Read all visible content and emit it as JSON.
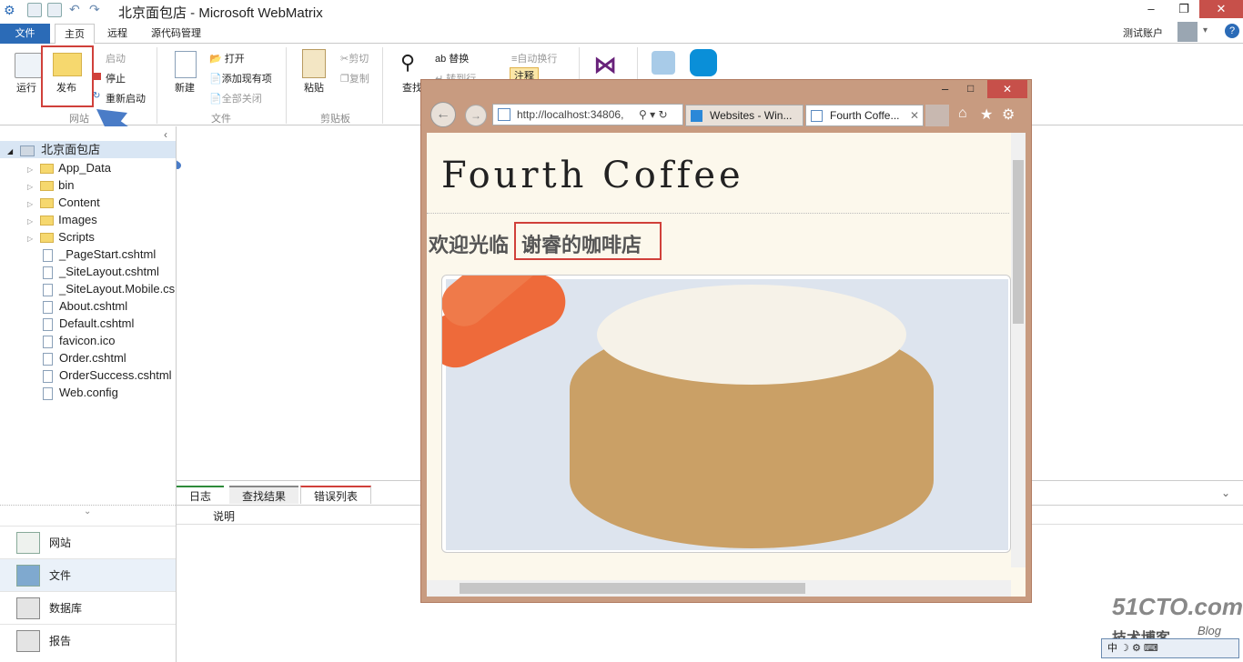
{
  "window": {
    "title": "北京面包店 - Microsoft WebMatrix",
    "user": "测试账户"
  },
  "tabs": [
    "文件",
    "主页",
    "远程",
    "源代码管理"
  ],
  "ribbon": {
    "run": "运行",
    "publish": "发布",
    "start": "启动",
    "stop": "停止",
    "restart": "重新启动",
    "site_group": "网站",
    "new": "新建",
    "open": "打开",
    "add_existing": "添加现有项",
    "close_all": "全部关闭",
    "file_group": "文件",
    "paste": "粘贴",
    "cut": "剪切",
    "copy": "复制",
    "clipboard_group": "剪贴板",
    "find": "查找",
    "replace": "替换",
    "goto": "转到行",
    "wrap": "自动换行",
    "comment": "注释"
  },
  "tree": {
    "root": "北京面包店",
    "items": [
      {
        "label": "App_Data",
        "type": "folder"
      },
      {
        "label": "bin",
        "type": "folder"
      },
      {
        "label": "Content",
        "type": "folder"
      },
      {
        "label": "Images",
        "type": "folder"
      },
      {
        "label": "Scripts",
        "type": "folder"
      },
      {
        "label": "_PageStart.cshtml",
        "type": "file"
      },
      {
        "label": "_SiteLayout.cshtml",
        "type": "file"
      },
      {
        "label": "_SiteLayout.Mobile.cs",
        "type": "file"
      },
      {
        "label": "About.cshtml",
        "type": "file"
      },
      {
        "label": "Default.cshtml",
        "type": "file"
      },
      {
        "label": "favicon.ico",
        "type": "file"
      },
      {
        "label": "Order.cshtml",
        "type": "file"
      },
      {
        "label": "OrderSuccess.cshtml",
        "type": "file"
      },
      {
        "label": "Web.config",
        "type": "file"
      }
    ]
  },
  "workspaces": [
    "网站",
    "文件",
    "数据库",
    "报告"
  ],
  "bottom_tabs": [
    "日志",
    "查找结果",
    "错误列表"
  ],
  "bottom_column": "说明",
  "browser": {
    "address": "http://localhost:34806,",
    "tab1": "Websites - Win...",
    "tab2": "Fourth Coffe...",
    "site_title": "Fourth Coffee",
    "welcome": "欢迎光临",
    "shop_name": "谢睿的咖啡店"
  },
  "watermark": {
    "line1": "51CTO.com",
    "line2": "技术博客",
    "line3": "Blog"
  },
  "colors": {
    "accent": "#2b6bb7",
    "highlight": "#d0403a",
    "arrow": "#4a7cc7"
  }
}
